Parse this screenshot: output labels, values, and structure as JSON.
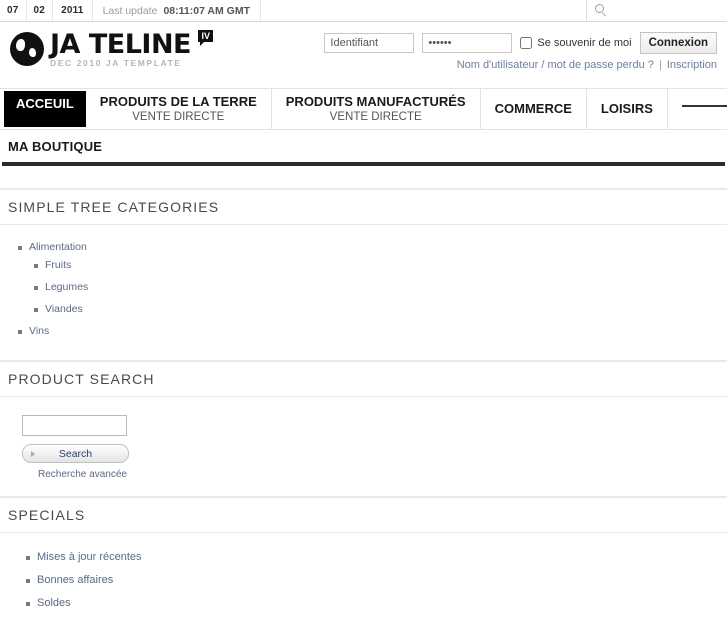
{
  "topbar": {
    "day": "07",
    "month": "02",
    "year": "2011",
    "last_update_label": "Last update",
    "last_update_time": "08:11:07 AM GMT",
    "search_icon": "search-icon"
  },
  "header": {
    "logo_name": "JA TELINE",
    "logo_badge": "IV",
    "logo_subtitle": "DEC 2010 JA TEMPLATE",
    "globe_icon": "globe-icon"
  },
  "login": {
    "username_placeholder": "Identifiant",
    "username_value": "",
    "password_value": "••••••",
    "remember_label": "Se souvenir de moi",
    "remember_checked": false,
    "submit_label": "Connexion",
    "forgot_link": "Nom d'utilisateur / mot de passe perdu ?",
    "separator": "|",
    "register_link": "Inscription"
  },
  "nav": {
    "items": [
      {
        "label": "ACCEUIL",
        "sub": "",
        "active": true
      },
      {
        "label": "PRODUITS DE LA TERRE",
        "sub": "VENTE DIRECTE",
        "active": false
      },
      {
        "label": "PRODUITS MANUFACTURÉS",
        "sub": "VENTE DIRECTE",
        "active": false
      },
      {
        "label": "COMMERCE",
        "sub": "",
        "active": false
      },
      {
        "label": "LOISIRS",
        "sub": "",
        "active": false
      },
      {
        "label": "",
        "sub": "",
        "active": false
      }
    ]
  },
  "boutique": {
    "title": "MA BOUTIQUE"
  },
  "sections": {
    "tree": {
      "title": "SIMPLE TREE CATEGORIES",
      "items": [
        {
          "label": "Alimentation",
          "children": [
            {
              "label": "Fruits"
            },
            {
              "label": "Legumes"
            },
            {
              "label": "Viandes"
            }
          ]
        },
        {
          "label": "Vins",
          "children": []
        }
      ]
    },
    "product_search": {
      "title": "PRODUCT SEARCH",
      "input_value": "",
      "button_label": "Search",
      "advanced_link": "Recherche avancée"
    },
    "specials": {
      "title": "SPECIALS",
      "items": [
        {
          "label": "Mises à jour récentes"
        },
        {
          "label": "Bonnes affaires"
        },
        {
          "label": "Soldes"
        }
      ]
    }
  },
  "colors": {
    "accent_link": "#5b6a87",
    "active_nav_bg": "#000000",
    "rule": "#e9e9e9"
  }
}
